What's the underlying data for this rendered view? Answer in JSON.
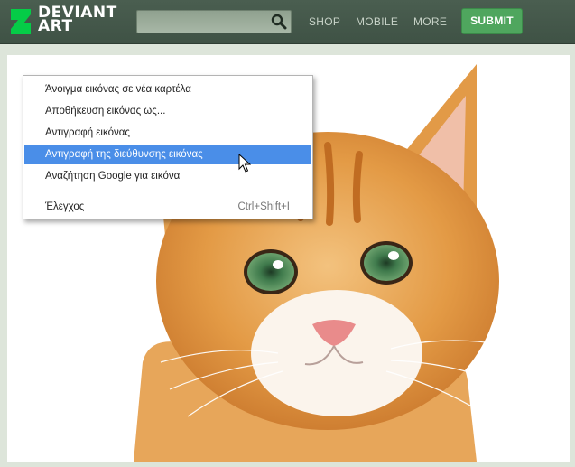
{
  "brand": {
    "line1": "DEVIANT",
    "line2": "ART",
    "mark": "deviantart-logo-icon"
  },
  "search": {
    "placeholder": "",
    "icon": "search-icon"
  },
  "nav": {
    "shop": "SHOP",
    "mobile": "MOBILE",
    "more": "MORE"
  },
  "submit": {
    "label": "SUBMIT"
  },
  "colors": {
    "topbar": "#465a4c",
    "submit": "#4fa65e",
    "highlight": "#4a8ee8",
    "page_bg": "#dde5da"
  },
  "context_menu": {
    "items": [
      {
        "label": "Άνοιγμα εικόνας σε νέα καρτέλα"
      },
      {
        "label": "Αποθήκευση εικόνας ως..."
      },
      {
        "label": "Αντιγραφή εικόνας"
      },
      {
        "label": "Αντιγραφή της διεύθυνσης εικόνας"
      },
      {
        "label": "Αναζήτηση Google για εικόνα"
      }
    ],
    "inspect": {
      "label": "Έλεγχος",
      "shortcut": "Ctrl+Shift+I"
    }
  }
}
